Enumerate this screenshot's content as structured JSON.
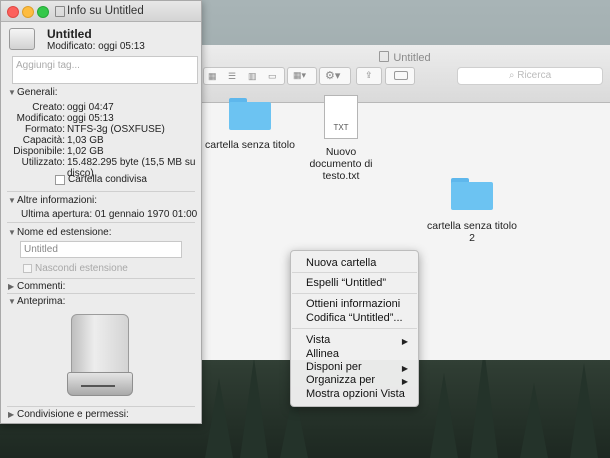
{
  "finder": {
    "title": "Untitled",
    "search_placeholder": "Ricerca",
    "items": [
      {
        "label": "cartella senza titolo",
        "type": "folder"
      },
      {
        "label": "Nuovo documento di testo.txt",
        "type": "document",
        "badge": "TXT"
      },
      {
        "label": "cartella senza titolo 2",
        "type": "folder"
      }
    ]
  },
  "info": {
    "window_title": "Info su Untitled",
    "name": "Untitled",
    "modified_summary": "Modificato:  oggi 05:13",
    "tags_placeholder": "Aggiungi tag...",
    "general": {
      "header": "Generali:",
      "rows": [
        {
          "k": "Creato:",
          "v": "oggi 04:47"
        },
        {
          "k": "Modificato:",
          "v": "oggi 05:13"
        },
        {
          "k": "Formato:",
          "v": "NTFS-3g (OSXFUSE)"
        },
        {
          "k": "Capacità:",
          "v": "1,03 GB"
        },
        {
          "k": "Disponibile:",
          "v": "1,02 GB"
        },
        {
          "k": "Utilizzato:",
          "v": "15.482.295 byte (15,5 MB su"
        },
        {
          "k": "",
          "v": "disco)"
        }
      ],
      "shared_label": "Cartella condivisa"
    },
    "more_info": {
      "header": "Altre informazioni:",
      "last_opened": "Ultima apertura: 01 gennaio 1970 01:00"
    },
    "name_ext": {
      "header": "Nome ed estensione:",
      "value": "Untitled",
      "hide_ext_label": "Nascondi estensione"
    },
    "comments_header": "Commenti:",
    "preview_header": "Anteprima:",
    "sharing_header": "Condivisione e permessi:"
  },
  "context_menu": {
    "items": [
      {
        "label": "Nuova cartella"
      },
      {
        "label": "Espelli “Untitled”"
      },
      {
        "label": "Ottieni informazioni"
      },
      {
        "label": "Codifica “Untitled”..."
      },
      {
        "label": "Vista",
        "submenu": true
      },
      {
        "label": "Allinea"
      },
      {
        "label": "Disponi per",
        "submenu": true
      },
      {
        "label": "Organizza per",
        "submenu": true
      },
      {
        "label": "Mostra opzioni Vista"
      }
    ]
  },
  "colors": {
    "close": "#fc605c",
    "minimize": "#fdbc40",
    "zoom": "#34c84a",
    "folder": "#6cc3f2"
  }
}
